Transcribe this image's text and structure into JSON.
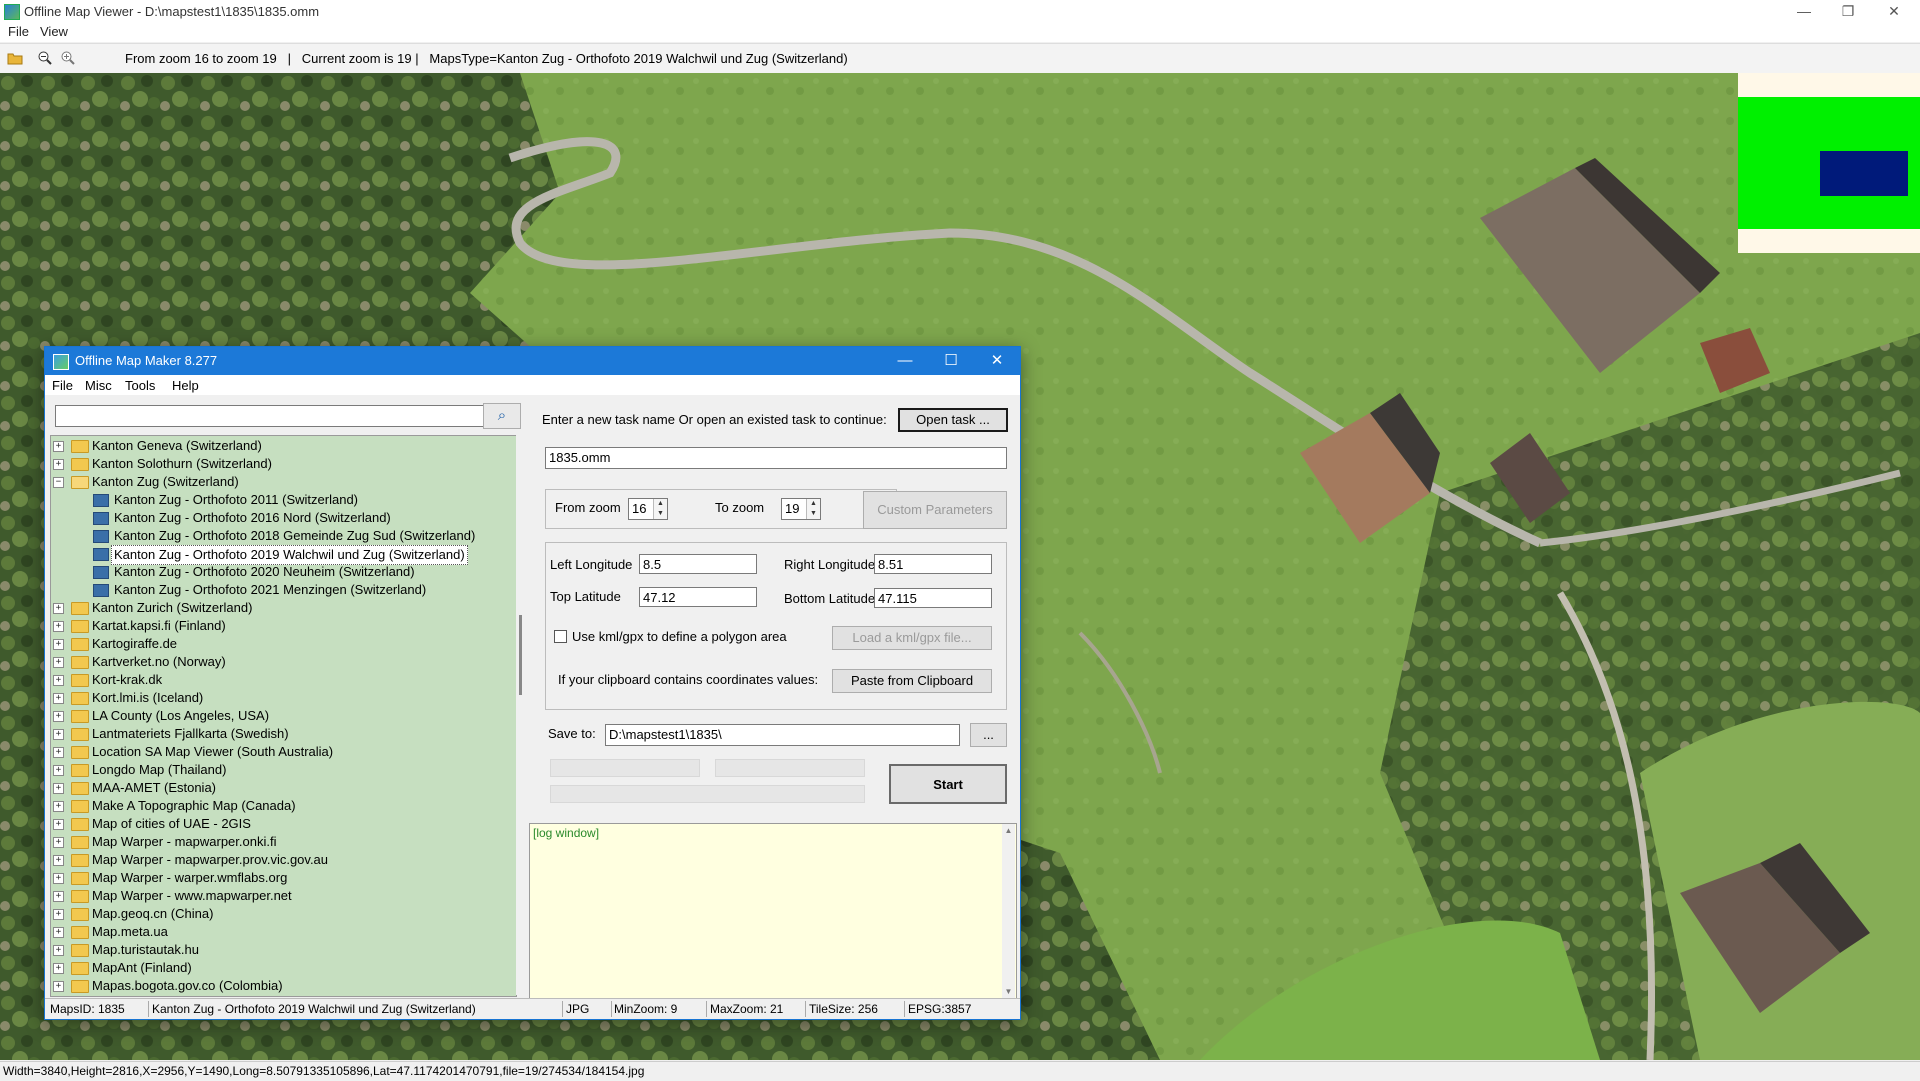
{
  "window": {
    "title": "Offline Map Viewer - D:\\mapstest1\\1835\\1835.omm",
    "minimize": "—",
    "maximize": "❐",
    "close": "✕"
  },
  "menu": [
    "File",
    "View"
  ],
  "toolbar": {
    "status": "From zoom 16 to zoom 19   |   Current zoom is 19 |   MapsType=Kanton Zug - Orthofoto 2019 Walchwil und Zug (Switzerland)"
  },
  "overview": {
    "colors": {
      "background": "#fff8e8",
      "area": "#00f000",
      "view": "#001a7a"
    }
  },
  "status_bar": "Width=3840,Height=2816,X=2956,Y=1490,Long=8.50791335105896,Lat=47.1174201470791,file=19/274534/184154.jpg",
  "dialog": {
    "title": "Offline Map Maker 8.277",
    "minimize": "—",
    "maximize": "☐",
    "close": "✕",
    "menu": [
      "File",
      "Misc",
      "Tools",
      "Help"
    ],
    "search_placeholder": "",
    "tree": [
      {
        "label": "Kanton Geneva (Switzerland)",
        "level": 0,
        "type": "folder",
        "expander": "+"
      },
      {
        "label": "Kanton Solothurn (Switzerland)",
        "level": 0,
        "type": "folder",
        "expander": "+"
      },
      {
        "label": "Kanton Zug (Switzerland)",
        "level": 0,
        "type": "folder-open",
        "expander": "−"
      },
      {
        "label": "Kanton Zug - Orthofoto 2011 (Switzerland)",
        "level": 1,
        "type": "map"
      },
      {
        "label": "Kanton Zug - Orthofoto 2016 Nord (Switzerland)",
        "level": 1,
        "type": "map"
      },
      {
        "label": "Kanton Zug - Orthofoto 2018 Gemeinde Zug Sud (Switzerland)",
        "level": 1,
        "type": "map"
      },
      {
        "label": "Kanton Zug - Orthofoto 2019 Walchwil und Zug (Switzerland)",
        "level": 1,
        "type": "map",
        "selected": true
      },
      {
        "label": "Kanton Zug - Orthofoto 2020 Neuheim (Switzerland)",
        "level": 1,
        "type": "map"
      },
      {
        "label": "Kanton Zug - Orthofoto 2021 Menzingen (Switzerland)",
        "level": 1,
        "type": "map"
      },
      {
        "label": "Kanton Zurich (Switzerland)",
        "level": 0,
        "type": "folder",
        "expander": "+"
      },
      {
        "label": "Kartat.kapsi.fi (Finland)",
        "level": 0,
        "type": "folder",
        "expander": "+"
      },
      {
        "label": "Kartogiraffe.de",
        "level": 0,
        "type": "folder",
        "expander": "+"
      },
      {
        "label": "Kartverket.no (Norway)",
        "level": 0,
        "type": "folder",
        "expander": "+"
      },
      {
        "label": "Kort-krak.dk",
        "level": 0,
        "type": "folder",
        "expander": "+"
      },
      {
        "label": "Kort.lmi.is (Iceland)",
        "level": 0,
        "type": "folder",
        "expander": "+"
      },
      {
        "label": "LA County (Los Angeles, USA)",
        "level": 0,
        "type": "folder",
        "expander": "+"
      },
      {
        "label": "Lantmateriets Fjallkarta (Swedish)",
        "level": 0,
        "type": "folder",
        "expander": "+"
      },
      {
        "label": "Location SA Map Viewer (South Australia)",
        "level": 0,
        "type": "folder",
        "expander": "+"
      },
      {
        "label": "Longdo Map (Thailand)",
        "level": 0,
        "type": "folder",
        "expander": "+"
      },
      {
        "label": "MAA-AMET (Estonia)",
        "level": 0,
        "type": "folder",
        "expander": "+"
      },
      {
        "label": "Make A Topographic Map (Canada)",
        "level": 0,
        "type": "folder",
        "expander": "+"
      },
      {
        "label": "Map of cities of UAE - 2GIS",
        "level": 0,
        "type": "folder",
        "expander": "+"
      },
      {
        "label": "Map Warper - mapwarper.onki.fi",
        "level": 0,
        "type": "folder",
        "expander": "+"
      },
      {
        "label": "Map Warper - mapwarper.prov.vic.gov.au",
        "level": 0,
        "type": "folder",
        "expander": "+"
      },
      {
        "label": "Map Warper - warper.wmflabs.org",
        "level": 0,
        "type": "folder",
        "expander": "+"
      },
      {
        "label": "Map Warper - www.mapwarper.net",
        "level": 0,
        "type": "folder",
        "expander": "+"
      },
      {
        "label": "Map.geoq.cn (China)",
        "level": 0,
        "type": "folder",
        "expander": "+"
      },
      {
        "label": "Map.meta.ua",
        "level": 0,
        "type": "folder",
        "expander": "+"
      },
      {
        "label": "Map.turistautak.hu",
        "level": 0,
        "type": "folder",
        "expander": "+"
      },
      {
        "label": "MapAnt (Finland)",
        "level": 0,
        "type": "folder",
        "expander": "+"
      },
      {
        "label": "Mapas.bogota.gov.co (Colombia)",
        "level": 0,
        "type": "folder",
        "expander": "+"
      }
    ],
    "task_prompt": "Enter a new task name Or open an existed task to continue:",
    "open_task_button": "Open task ...",
    "task_name": "1835.omm",
    "from_zoom_label": "From zoom",
    "from_zoom": "16",
    "to_zoom_label": "To zoom",
    "to_zoom": "19",
    "custom_params_button": "Custom Parameters",
    "left_longitude_label": "Left Longitude",
    "left_longitude": "8.5",
    "right_longitude_label": "Right Longitude",
    "right_longitude": "8.51",
    "top_latitude_label": "Top Latitude",
    "top_latitude": "47.12",
    "bottom_latitude_label": "Bottom Latitude",
    "bottom_latitude": "47.115",
    "kml_checkbox_label": "Use kml/gpx to define a polygon area",
    "load_kml_button": "Load a kml/gpx file...",
    "clipboard_label": "If your clipboard contains coordinates values:",
    "paste_button": "Paste from Clipboard",
    "save_to_label": "Save to:",
    "save_to": "D:\\mapstest1\\1835\\",
    "browse_button": "...",
    "start_button": "Start",
    "log_text": "[log window]",
    "status": {
      "maps_id": "MapsID: 1835",
      "map_name": "Kanton Zug - Orthofoto 2019 Walchwil und Zug (Switzerland)",
      "format": "JPG",
      "min_zoom": "MinZoom: 9",
      "max_zoom": "MaxZoom: 21",
      "tile_size": "TileSize: 256",
      "epsg": "EPSG:3857"
    }
  }
}
